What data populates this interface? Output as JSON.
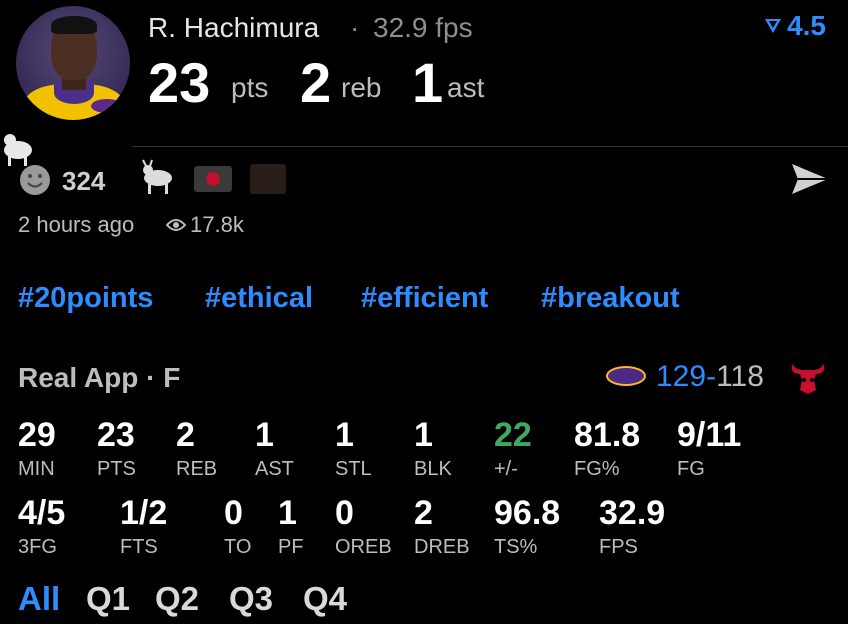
{
  "player": {
    "name": "R. Hachimura",
    "separator": "·",
    "fps": "32.9 fps",
    "rating": "4.5",
    "pts_value": "23",
    "pts_unit": "pts",
    "reb_value": "2",
    "reb_unit": "reb",
    "ast_value": "1",
    "ast_unit": "ast"
  },
  "social": {
    "reaction_count": "324",
    "time_ago": "2 hours ago",
    "views": "17.8k"
  },
  "tags": [
    "#20points",
    "#ethical",
    "#efficient",
    "#breakout"
  ],
  "game": {
    "source": "Real App · F",
    "score_home": "129",
    "score_sep": "-",
    "score_away": "118"
  },
  "stats": {
    "row1": [
      {
        "value": "29",
        "label": "MIN"
      },
      {
        "value": "23",
        "label": "PTS"
      },
      {
        "value": "2",
        "label": "REB"
      },
      {
        "value": "1",
        "label": "AST"
      },
      {
        "value": "1",
        "label": "STL"
      },
      {
        "value": "1",
        "label": "BLK"
      },
      {
        "value": "22",
        "label": "+/-"
      },
      {
        "value": "81.8",
        "label": "FG%"
      },
      {
        "value": "9/11",
        "label": "FG"
      }
    ],
    "row2": [
      {
        "value": "4/5",
        "label": "3FG"
      },
      {
        "value": "1/2",
        "label": "FTS"
      },
      {
        "value": "0",
        "label": "TO"
      },
      {
        "value": "1",
        "label": "PF"
      },
      {
        "value": "0",
        "label": "OREB"
      },
      {
        "value": "2",
        "label": "DREB"
      },
      {
        "value": "96.8",
        "label": "TS%"
      },
      {
        "value": "32.9",
        "label": "FPS"
      }
    ]
  },
  "quarters": [
    "All",
    "Q1",
    "Q2",
    "Q3",
    "Q4"
  ],
  "colors": {
    "accent": "#2f8cff",
    "positive": "#3daa5f"
  },
  "icons": [
    "goat-icon",
    "smiley-icon",
    "japan-flag-icon",
    "eye-icon",
    "send-icon",
    "rating-arrow-icon",
    "lakers-logo-icon",
    "bulls-logo-icon"
  ]
}
